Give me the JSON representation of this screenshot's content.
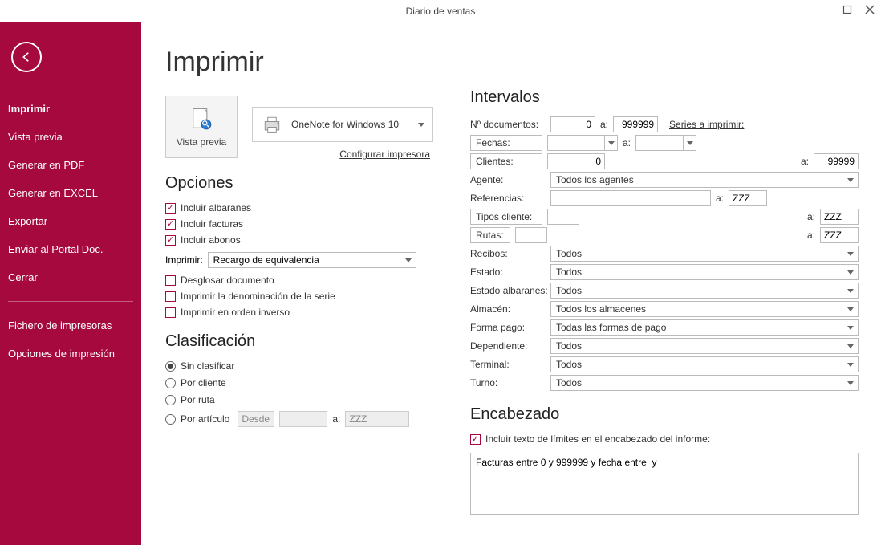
{
  "window": {
    "title": "Diario de ventas"
  },
  "sidebar": {
    "items": [
      "Imprimir",
      "Vista previa",
      "Generar en PDF",
      "Generar en EXCEL",
      "Exportar",
      "Enviar al Portal Doc.",
      "Cerrar"
    ],
    "bottom": [
      "Fichero de impresoras",
      "Opciones de impresión"
    ]
  },
  "page_title": "Imprimir",
  "preview": {
    "label": "Vista previa"
  },
  "printer": {
    "name": "OneNote for Windows 10",
    "config": "Configurar impresora"
  },
  "opciones": {
    "heading": "Opciones",
    "albaranes": "Incluir albaranes",
    "facturas": "Incluir facturas",
    "abonos": "Incluir abonos",
    "imprimir_lbl": "Imprimir:",
    "imprimir_val": "Recargo de equivalencia",
    "desglosar": "Desglosar documento",
    "denom": "Imprimir la denominación de la serie",
    "inverso": "Imprimir en orden inverso"
  },
  "clasif": {
    "heading": "Clasificación",
    "sin": "Sin clasificar",
    "cliente": "Por cliente",
    "ruta": "Por ruta",
    "articulo": "Por artículo",
    "desde": "Desde:",
    "a": "a:",
    "a_val": "ZZZ"
  },
  "interv": {
    "heading": "Intervalos",
    "ndoc": "Nº documentos:",
    "ndoc_from": "0",
    "ndoc_to": "999999",
    "series_link": "Series a imprimir:",
    "fechas": "Fechas:",
    "clientes": "Clientes:",
    "clientes_from": "0",
    "clientes_to": "99999",
    "agente": "Agente:",
    "agente_val": "Todos los agentes",
    "ref": "Referencias:",
    "ref_to": "ZZZ",
    "tipos": "Tipos cliente:",
    "tipos_to": "ZZZ",
    "rutas": "Rutas:",
    "rutas_to": "ZZZ",
    "recibos": "Recibos:",
    "recibos_val": "Todos",
    "estado": "Estado:",
    "estado_val": "Todos",
    "estado_alb": "Estado albaranes:",
    "estado_alb_val": "Todos",
    "almacen": "Almacén:",
    "almacen_val": "Todos los almacenes",
    "fpago": "Forma pago:",
    "fpago_val": "Todas las formas de pago",
    "dep": "Dependiente:",
    "dep_val": "Todos",
    "term": "Terminal:",
    "term_val": "Todos",
    "turno": "Turno:",
    "turno_val": "Todos",
    "a": "a:"
  },
  "encab": {
    "heading": "Encabezado",
    "chk": "Incluir texto de límites en el encabezado del informe:",
    "text": "Facturas entre 0 y 999999 y fecha entre  y"
  }
}
